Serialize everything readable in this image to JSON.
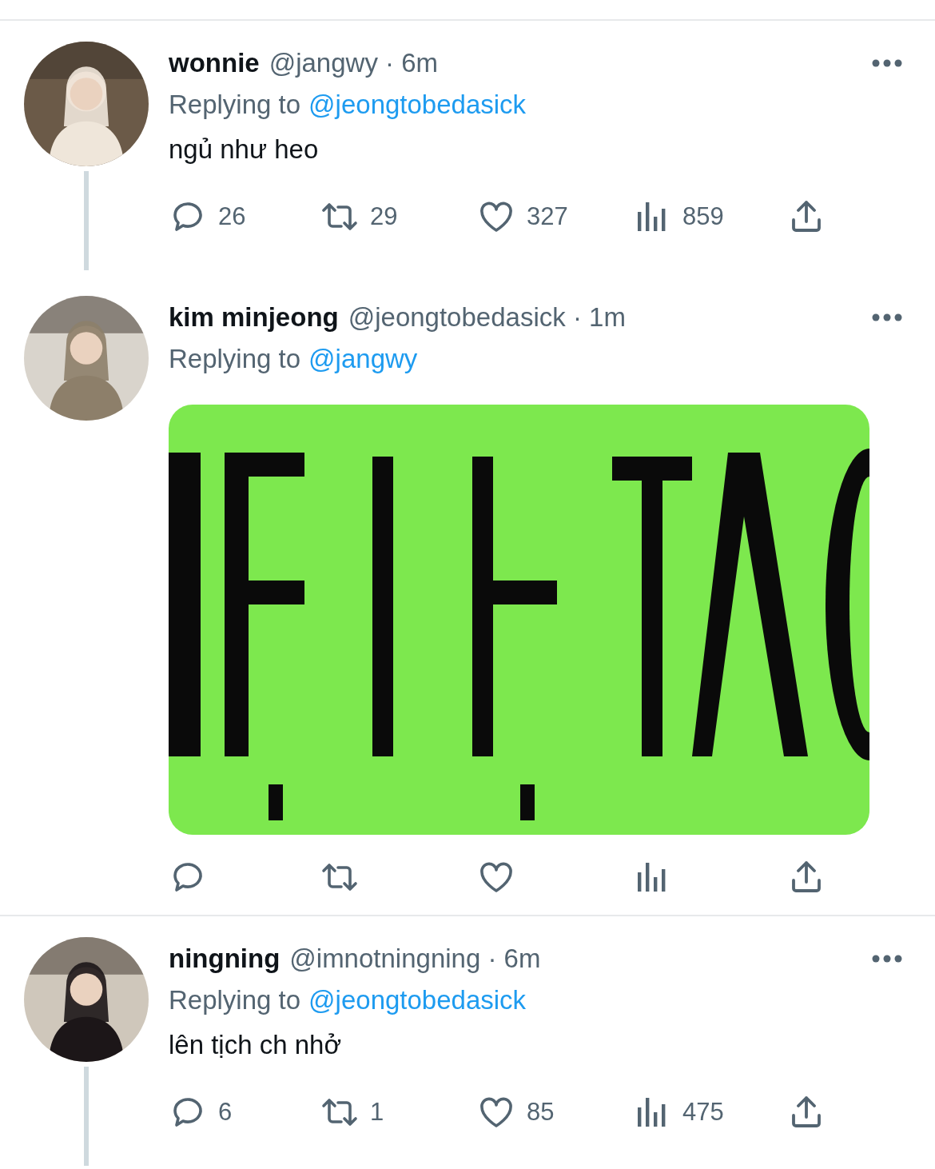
{
  "tweets": [
    {
      "name": "wonnie",
      "meta": "@jangwy · 6m",
      "replying_label": "Replying to",
      "replying_to": "@jeongtobedasick",
      "text": "ngủ như heo",
      "thread_line": true,
      "divider_after": false,
      "actions": [
        {
          "kind": "reply",
          "count": "26"
        },
        {
          "kind": "retweet",
          "count": "29"
        },
        {
          "kind": "like",
          "count": "327"
        },
        {
          "kind": "views",
          "count": "859"
        },
        {
          "kind": "share"
        }
      ]
    },
    {
      "name": "kim minjeong",
      "meta": "@jeongtobedasick · 1m",
      "replying_label": "Replying to",
      "replying_to": "@jangwy",
      "thread_line": false,
      "divider_after": true,
      "actions": [
        {
          "kind": "reply"
        },
        {
          "kind": "retweet"
        },
        {
          "kind": "like"
        },
        {
          "kind": "views"
        },
        {
          "kind": "share"
        }
      ]
    },
    {
      "name": "ningning",
      "meta": "@imnotningning · 6m",
      "replying_label": "Replying to",
      "replying_to": "@jeongtobedasick",
      "text": "lên tịch ch nhở",
      "thread_line": true,
      "divider_after": false,
      "actions": [
        {
          "kind": "reply",
          "count": "6"
        },
        {
          "kind": "retweet",
          "count": "1"
        },
        {
          "kind": "like",
          "count": "85"
        },
        {
          "kind": "views",
          "count": "475"
        },
        {
          "kind": "share"
        }
      ]
    }
  ]
}
